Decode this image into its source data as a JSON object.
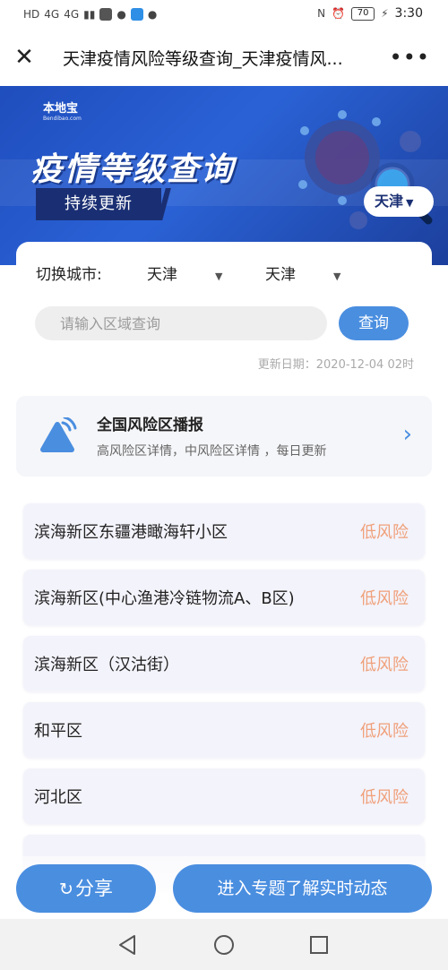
{
  "status_bar": {
    "left_indicators": [
      "HD",
      "4G",
      "4G"
    ],
    "battery": "70",
    "time": "3:30"
  },
  "nav": {
    "title": "天津疫情风险等级查询_天津疫情风..."
  },
  "banner": {
    "brand_name": "本地宝",
    "brand_domain": "Bendibao.com",
    "title": "疫情等级查询",
    "badge": "持续更新",
    "city": "天津"
  },
  "filter": {
    "label": "切换城市:",
    "province": "天津",
    "city": "天津"
  },
  "search": {
    "placeholder": "请输入区域查询",
    "button": "查询"
  },
  "update_date": "更新日期：2020-12-04 02时",
  "broadcast": {
    "title": "全国风险区播报",
    "subtitle": "高风险区详情，中风险区详情 ，每日更新"
  },
  "areas": [
    {
      "name": "滨海新区东疆港瞰海轩小区",
      "risk": "低风险"
    },
    {
      "name": "滨海新区(中心渔港冷链物流A、B区)",
      "risk": "低风险"
    },
    {
      "name": "滨海新区（汉沽街）",
      "risk": "低风险"
    },
    {
      "name": "和平区",
      "risk": "低风险"
    },
    {
      "name": "河北区",
      "risk": "低风险"
    }
  ],
  "bottom": {
    "share": "分享",
    "enter": "进入专题了解实时动态"
  },
  "colors": {
    "accent": "#4a8ee0",
    "banner": "#2a62d6",
    "low_risk": "#f0a07a"
  }
}
